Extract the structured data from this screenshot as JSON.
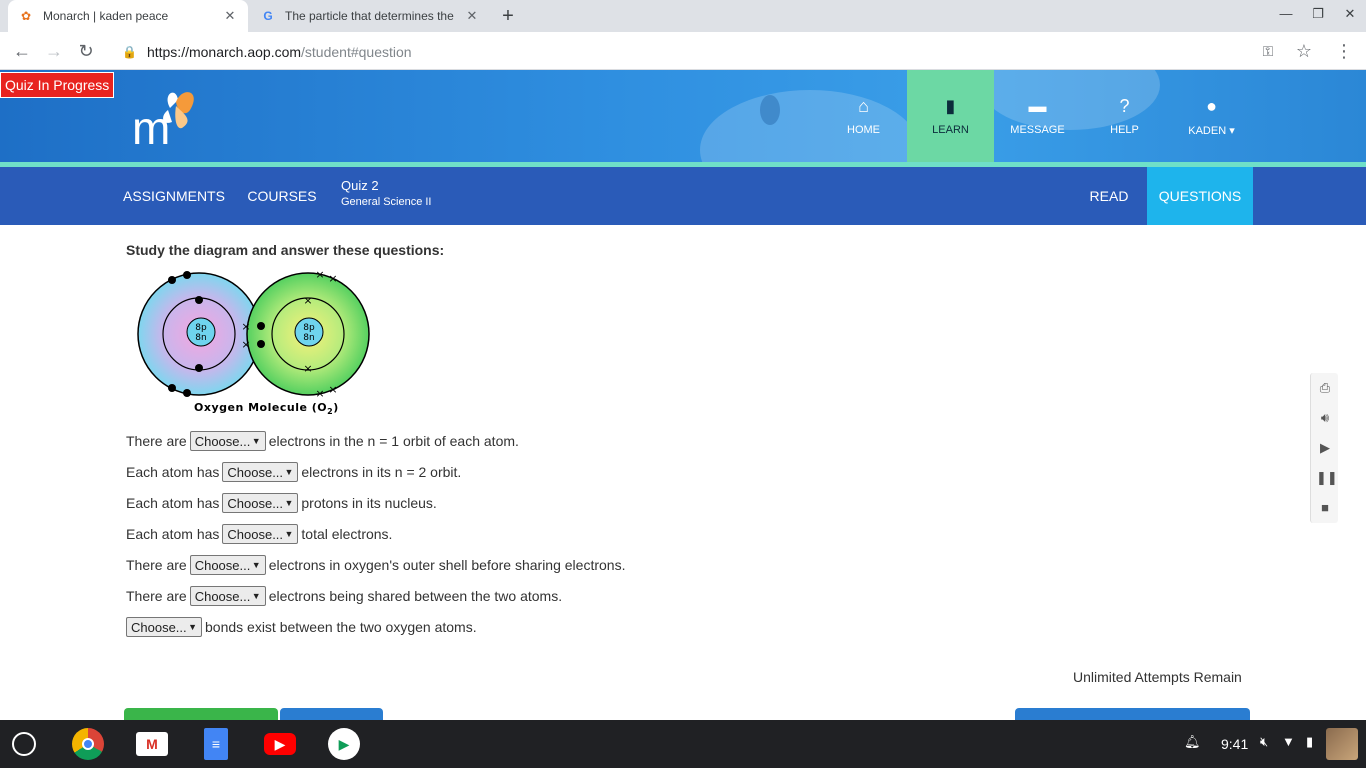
{
  "browser": {
    "tabs": [
      {
        "title": "Monarch | kaden peace",
        "active": true,
        "favicon": "butterfly-icon"
      },
      {
        "title": "The particle that determines the",
        "active": false,
        "favicon": "google-icon"
      }
    ],
    "url_host": "https://monarch.aop.com",
    "url_path": "/student#question"
  },
  "site": {
    "quiz_flag": "Quiz In Progress",
    "logo_letter": "m",
    "nav": [
      {
        "label": "HOME",
        "icon": "home-icon"
      },
      {
        "label": "LEARN",
        "icon": "book-icon",
        "active": true
      },
      {
        "label": "MESSAGE",
        "icon": "chat-icon"
      },
      {
        "label": "HELP",
        "icon": "help-icon"
      },
      {
        "label": "KADEN",
        "icon": "user-icon"
      }
    ],
    "subnav": {
      "assignments": "ASSIGNMENTS",
      "courses": "COURSES",
      "quiz_title": "Quiz 2",
      "course_name": "General Science II",
      "read": "READ",
      "questions": "QUESTIONS"
    }
  },
  "content": {
    "instruction": "Study the diagram and answer these questions:",
    "diagram": {
      "caption_main": "Oxygen Molecule (O",
      "caption_sub": "2",
      "caption_end": ")",
      "nucleus_top": "8p",
      "nucleus_bottom": "8n"
    },
    "select_placeholder": "Choose...",
    "questions": [
      {
        "before": "There are",
        "after": "electrons in the n = 1 orbit of each atom."
      },
      {
        "before": "Each atom has",
        "after": "electrons in its n = 2 orbit."
      },
      {
        "before": "Each atom has",
        "after": "protons in its nucleus."
      },
      {
        "before": "Each atom has",
        "after": "total electrons."
      },
      {
        "before": "There are",
        "after": "electrons in oxygen's outer shell before sharing electrons."
      },
      {
        "before": "There are",
        "after": "electrons being shared between the two atoms."
      },
      {
        "before": "",
        "after": "bonds exist between the two oxygen atoms."
      }
    ],
    "attempts": "Unlimited Attempts Remain"
  },
  "sidetools": [
    "print-icon",
    "volume-icon",
    "play-icon",
    "pause-icon",
    "stop-icon"
  ],
  "shelf": {
    "apps": [
      "chrome-icon",
      "gmail-icon",
      "docs-icon",
      "youtube-icon",
      "play-store-icon"
    ],
    "time": "9:41"
  },
  "colors": {
    "header_blue": "#2f8fe0",
    "subnav_blue": "#2a5bb8",
    "active_learn": "#6cd8a4",
    "active_questions": "#1eb4ec",
    "quiz_flag_red": "#e8231f"
  }
}
